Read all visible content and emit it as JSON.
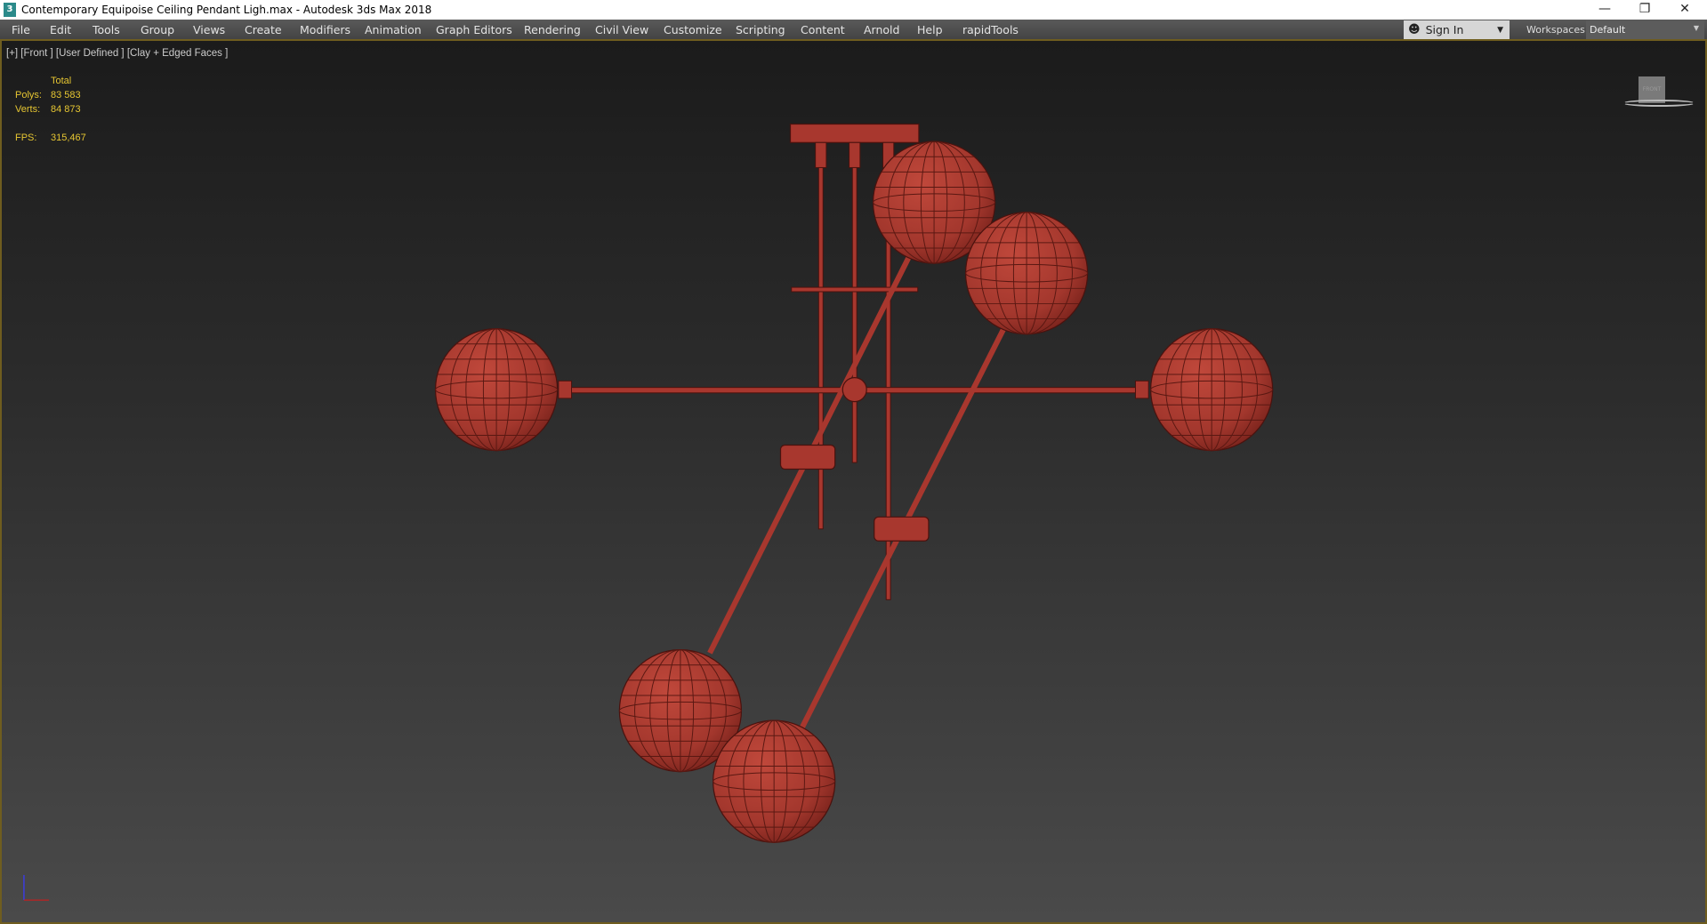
{
  "window": {
    "title": "Contemporary Equipoise Ceiling Pendant Ligh.max - Autodesk 3ds Max 2018",
    "icon": "3ds-max-icon",
    "controls": [
      "minimize",
      "restore",
      "close"
    ]
  },
  "menu": [
    "File",
    "Edit",
    "Tools",
    "Group",
    "Views",
    "Create",
    "Modifiers",
    "Animation",
    "Graph Editors",
    "Rendering",
    "Civil View",
    "Customize",
    "Scripting",
    "Content",
    "Arnold",
    "Help",
    "rapidTools"
  ],
  "signin": {
    "label": "Sign In"
  },
  "workspaces": {
    "label": "Workspaces:",
    "value": "Default"
  },
  "viewport": {
    "label": "[+] [Front ] [User Defined ] [Clay + Edged Faces ]",
    "stats": {
      "header": "Total",
      "polys_label": "Polys:",
      "polys": "83 583",
      "verts_label": "Verts:",
      "verts": "84 873",
      "fps_label": "FPS:",
      "fps": "315,467"
    },
    "viewcube": "FRONT",
    "object_color": "#a8372e"
  }
}
